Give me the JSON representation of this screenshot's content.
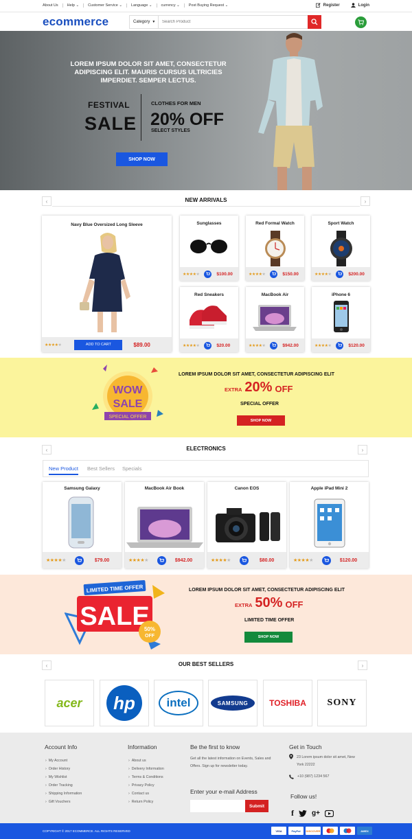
{
  "topbar": {
    "links": [
      "About Us",
      "Help ⌄",
      "Customer Service ⌄",
      "Language ⌄",
      "currency ⌄",
      "Post Buying Request ⌄"
    ],
    "register": "Register",
    "login": "Login"
  },
  "header": {
    "logo": "ecommerce",
    "category_label": "Category",
    "search_placeholder": "Search Product"
  },
  "hero": {
    "headline": "LOREM IPSUM DOLOR SIT AMET, CONSECTETUR ADIPISCING ELIT. MAURIS CURSUS ULTRICIES IMPERDIET. SEMPER LECTUS.",
    "festival": "FESTIVAL",
    "sale": "SALE",
    "clothes": "CLOTHES FOR MEN",
    "discount": "20% OFF",
    "select": "SELECT STYLES",
    "cta": "SHOP NOW"
  },
  "new_arrivals": {
    "title": "NEW ARRIVALS",
    "featured": {
      "name": "Navy Blue Oversized Long Sleeve",
      "cta": "ADD TO CART",
      "price": "$89.00",
      "rating": 4
    },
    "products": [
      {
        "name": "Sunglasses",
        "price": "$100.00",
        "rating": 4
      },
      {
        "name": "Red Formal Watch",
        "price": "$150.00",
        "rating": 4
      },
      {
        "name": "Sport Watch",
        "price": "$200.00",
        "rating": 4
      },
      {
        "name": "Red Sneakers",
        "price": "$20.00",
        "rating": 4
      },
      {
        "name": "MacBook Air",
        "price": "$942.00",
        "rating": 4
      },
      {
        "name": "iPhone 6",
        "price": "$120.00",
        "rating": 4
      }
    ]
  },
  "promo1": {
    "badge_top": "WOW",
    "badge_mid": "SALE",
    "badge_ribbon": "SPECIAL OFFER",
    "headline": "LOREM IPSUM DOLOR SIT AMET, CONSECTETUR ADIPISCING ELIT",
    "extra": "EXTRA",
    "percent": "20%",
    "off": "OFF",
    "sub": "SPECIAL OFFER",
    "cta": "SHOP NOW"
  },
  "electronics": {
    "title": "ELECTRONICS",
    "tabs": [
      "New Product",
      "Best Sellers",
      "Specials"
    ],
    "products": [
      {
        "name": "Samsung Galaxy",
        "price": "$79.00",
        "rating": 4
      },
      {
        "name": "MacBook Air Book",
        "price": "$942.00",
        "rating": 4
      },
      {
        "name": "Canon EOS",
        "price": "$80.00",
        "rating": 4
      },
      {
        "name": "Apple iPad Mini 2",
        "price": "$120.00",
        "rating": 4
      }
    ]
  },
  "promo2": {
    "badge_ribbon": "LIMITED TIME OFFER",
    "badge_sale": "SALE",
    "badge_pct": "50%",
    "badge_off": "OFF",
    "headline": "LOREM IPSUM DOLOR SIT AMET, CONSECTETUR ADIPISCING ELIT",
    "extra": "EXTRA",
    "percent": "50%",
    "off": "OFF",
    "sub": "LIMITED TIME OFFER",
    "cta": "SHOP NOW"
  },
  "best_sellers": {
    "title": "OUR BEST SELLERS",
    "brands": [
      "acer",
      "hp",
      "intel",
      "SAMSUNG",
      "TOSHIBA",
      "SONY"
    ]
  },
  "footer": {
    "account_title": "Account Info",
    "account_items": [
      "My Account",
      "Order History",
      "My Wishlist",
      "Order Tracking",
      "Shipping Information",
      "Gift Vouchers"
    ],
    "info_title": "Information",
    "info_items": [
      "About us",
      "Delivery Information",
      "Terms & Conditions",
      "Privacy Policy",
      "Contact us",
      "Return Policy"
    ],
    "newsletter_title": "Be the first to know",
    "newsletter_text": "Get all the latest information on Events, Sales and Offers. Sign up for newsletter today.",
    "email_label": "Enter your e-mail Address",
    "submit": "Submit",
    "contact_title": "Get in Touch",
    "address": "23 Lorem ipsum dolor sit amet, New York 22222",
    "phone": "+10 (987) 1234 567",
    "follow": "Follow us!",
    "copyright": "COPYRIGHT © 2017 ECOMMERCE. ALL RIGHTS RESERVED",
    "payments": [
      "VISA",
      "PayPal",
      "DISCOVER",
      "MC",
      "Maestro",
      "AMEX"
    ]
  },
  "colors": {
    "brand_blue": "#1a57e0",
    "accent_red": "#e02828",
    "green": "#2a9d3a",
    "star": "#e49b1b"
  }
}
